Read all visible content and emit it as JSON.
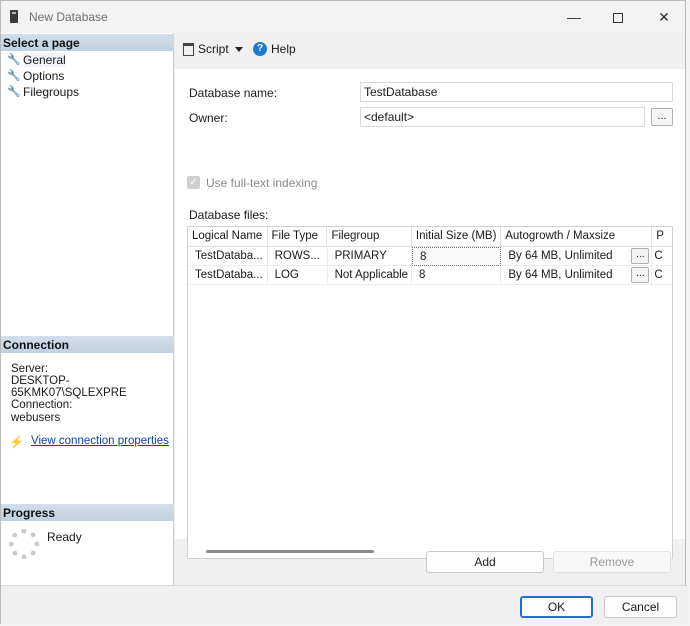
{
  "window": {
    "title": "New Database",
    "minimize": "—",
    "close": "✕"
  },
  "left": {
    "select_page_header": "Select a page",
    "pages": [
      {
        "label": "General",
        "icon": "wrench-icon"
      },
      {
        "label": "Options",
        "icon": "wrench-icon"
      },
      {
        "label": "Filegroups",
        "icon": "wrench-icon"
      }
    ],
    "connection_header": "Connection",
    "server_label": "Server:",
    "server_value": "DESKTOP-65KMK07\\SQLEXPRE",
    "connection_label": "Connection:",
    "connection_value": "webusers",
    "view_connection_link": "View connection properties",
    "progress_header": "Progress",
    "progress_status": "Ready"
  },
  "toolbar": {
    "script_label": "Script",
    "help_label": "Help"
  },
  "form": {
    "db_name_label": "Database name:",
    "db_name_value": "TestDatabase",
    "owner_label": "Owner:",
    "owner_value": "<default>",
    "ellipsis": "...",
    "fulltext_label": "Use full-text indexing",
    "db_files_label": "Database files:"
  },
  "grid": {
    "columns": [
      "Logical Name",
      "File Type",
      "Filegroup",
      "Initial Size (MB)",
      "Autogrowth / Maxsize",
      "P"
    ],
    "rows": [
      [
        "TestDataba...",
        "ROWS...",
        "PRIMARY",
        "8",
        "By 64 MB, Unlimited",
        "C"
      ],
      [
        "TestDataba...",
        "LOG",
        "Not Applicable",
        "8",
        "By 64 MB, Unlimited",
        "C"
      ]
    ]
  },
  "buttons": {
    "add": "Add",
    "remove": "Remove",
    "ok": "OK",
    "cancel": "Cancel"
  }
}
